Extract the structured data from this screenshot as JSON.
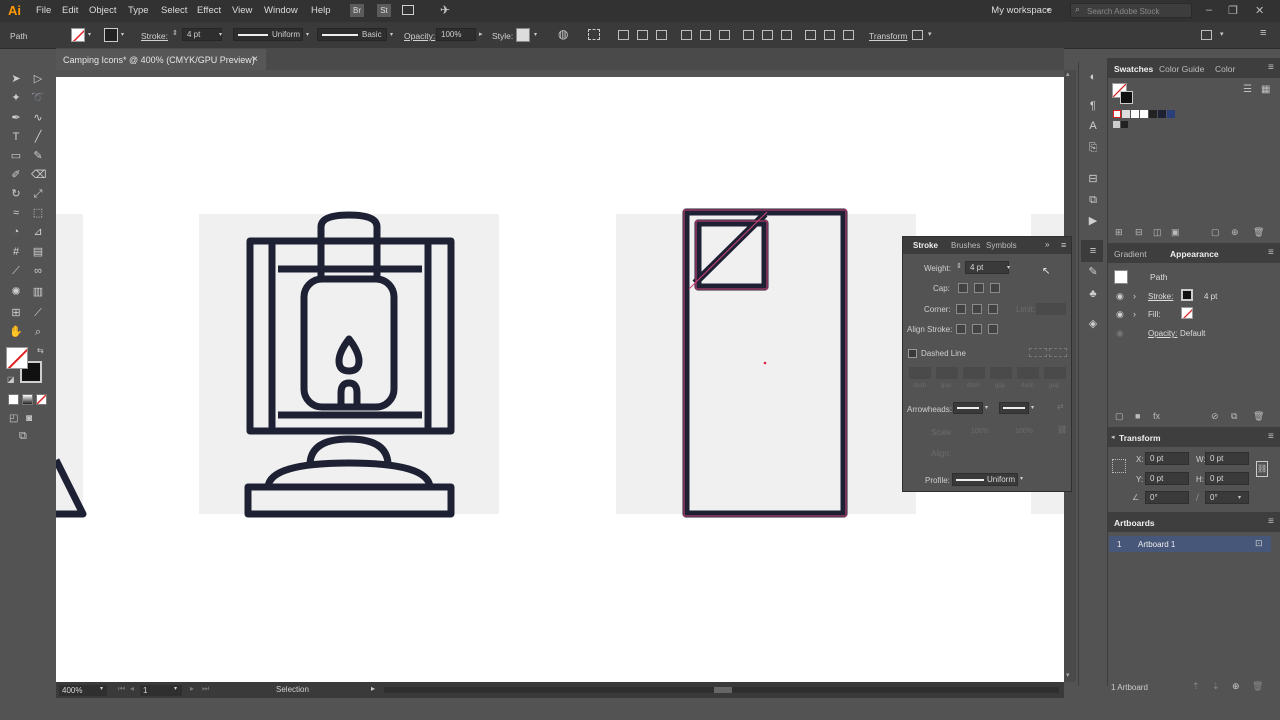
{
  "app": {
    "logo": "Ai",
    "workspace": "My workspace",
    "search_placeholder": "Search Adobe Stock"
  },
  "menu": [
    "File",
    "Edit",
    "Object",
    "Type",
    "Select",
    "Effect",
    "View",
    "Window",
    "Help"
  ],
  "menu_extras": {
    "bridge": "Br",
    "stock": "St"
  },
  "control": {
    "selection_type": "Path",
    "stroke_label": "Stroke:",
    "stroke_weight": "4 pt",
    "profile": "Uniform",
    "brush": "Basic",
    "opacity_label": "Opacity:",
    "opacity_value": "100%",
    "style_label": "Style:",
    "transform_label": "Transform"
  },
  "document": {
    "tab_title": "Camping Icons* @ 400% (CMYK/GPU Preview)",
    "close_glyph": "×"
  },
  "status": {
    "zoom": "400%",
    "artboard_num": "1",
    "tool_name": "Selection"
  },
  "stroke_panel": {
    "tabs": [
      "Stroke",
      "Brushes",
      "Symbols"
    ],
    "weight_label": "Weight:",
    "weight_value": "4 pt",
    "cap_label": "Cap:",
    "corner_label": "Corner:",
    "limit_label": "Limit:",
    "align_label": "Align Stroke:",
    "dashed_label": "Dashed Line",
    "dash_labels": [
      "dash",
      "gap",
      "dash",
      "gap",
      "dash",
      "gap"
    ],
    "arrowheads_label": "Arrowheads:",
    "scale_label": "Scale:",
    "scale_values": [
      "100%",
      "100%"
    ],
    "align_arrow_label": "Align:",
    "profile_label": "Profile:",
    "profile_value": "Uniform"
  },
  "swatches_panel": {
    "tabs": [
      "Swatches",
      "Color Guide",
      "Color"
    ]
  },
  "appearance_panel": {
    "tabs": [
      "Gradient",
      "Appearance"
    ],
    "object_type": "Path",
    "stroke_label": "Stroke:",
    "stroke_value": "4 pt",
    "fill_label": "Fill:",
    "opacity_label": "Opacity:",
    "opacity_value": "Default"
  },
  "transform_panel": {
    "title": "Transform",
    "x_label": "X:",
    "x_value": "0 pt",
    "y_label": "Y:",
    "y_value": "0 pt",
    "w_label": "W:",
    "w_value": "0 pt",
    "h_label": "H:",
    "h_value": "0 pt",
    "rotate_value": "0°",
    "shear_value": "0°"
  },
  "artboards_panel": {
    "title": "Artboards",
    "items": [
      {
        "num": "1",
        "name": "Artboard 1"
      }
    ],
    "footer": "1 Artboard"
  },
  "colors": {
    "icon_stroke": "#1e2134",
    "selection": "#d4447a",
    "accent": "#ff9a00"
  }
}
